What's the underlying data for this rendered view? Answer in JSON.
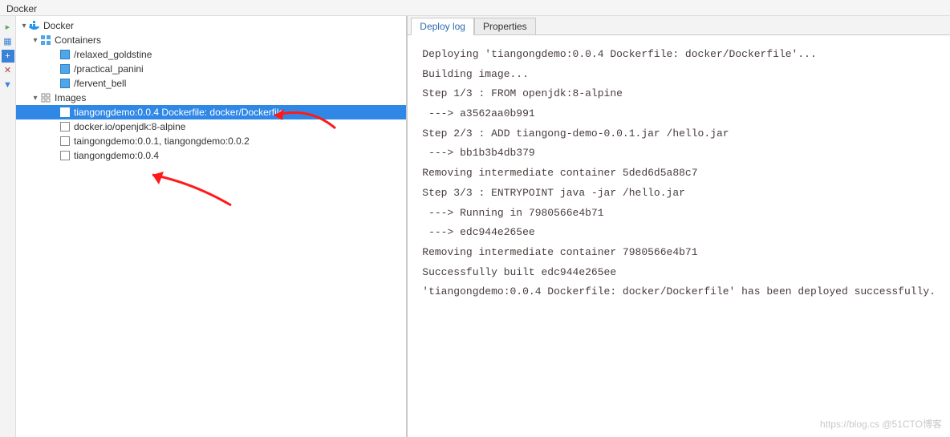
{
  "window": {
    "title": "Docker"
  },
  "tree": {
    "root": {
      "label": "Docker"
    },
    "containers": {
      "label": "Containers",
      "items": [
        {
          "label": "/relaxed_goldstine"
        },
        {
          "label": "/practical_panini"
        },
        {
          "label": "/fervent_bell"
        }
      ]
    },
    "images": {
      "label": "Images",
      "items": [
        {
          "label": "tiangongdemo:0.0.4 Dockerfile: docker/Dockerfile",
          "selected": true
        },
        {
          "label": "docker.io/openjdk:8-alpine"
        },
        {
          "label": "taingongdemo:0.0.1, tiangongdemo:0.0.2"
        },
        {
          "label": "tiangongdemo:0.0.4"
        }
      ]
    }
  },
  "tabs": {
    "deploy_log": "Deploy log",
    "properties": "Properties"
  },
  "log": {
    "lines": [
      "Deploying 'tiangongdemo:0.0.4 Dockerfile: docker/Dockerfile'...",
      "Building image...",
      "Step 1/3 : FROM openjdk:8-alpine",
      "",
      " ---> a3562aa0b991",
      "",
      "Step 2/3 : ADD tiangong-demo-0.0.1.jar /hello.jar",
      "",
      " ---> bb1b3b4db379",
      "",
      "Removing intermediate container 5ded6d5a88c7",
      "",
      "Step 3/3 : ENTRYPOINT java -jar /hello.jar",
      "",
      " ---> Running in 7980566e4b71",
      "",
      " ---> edc944e265ee",
      "",
      "Removing intermediate container 7980566e4b71",
      "",
      "Successfully built edc944e265ee",
      "",
      "'tiangongdemo:0.0.4 Dockerfile: docker/Dockerfile' has been deployed successfully."
    ]
  },
  "watermark": "https://blog.cs     @51CTO博客"
}
